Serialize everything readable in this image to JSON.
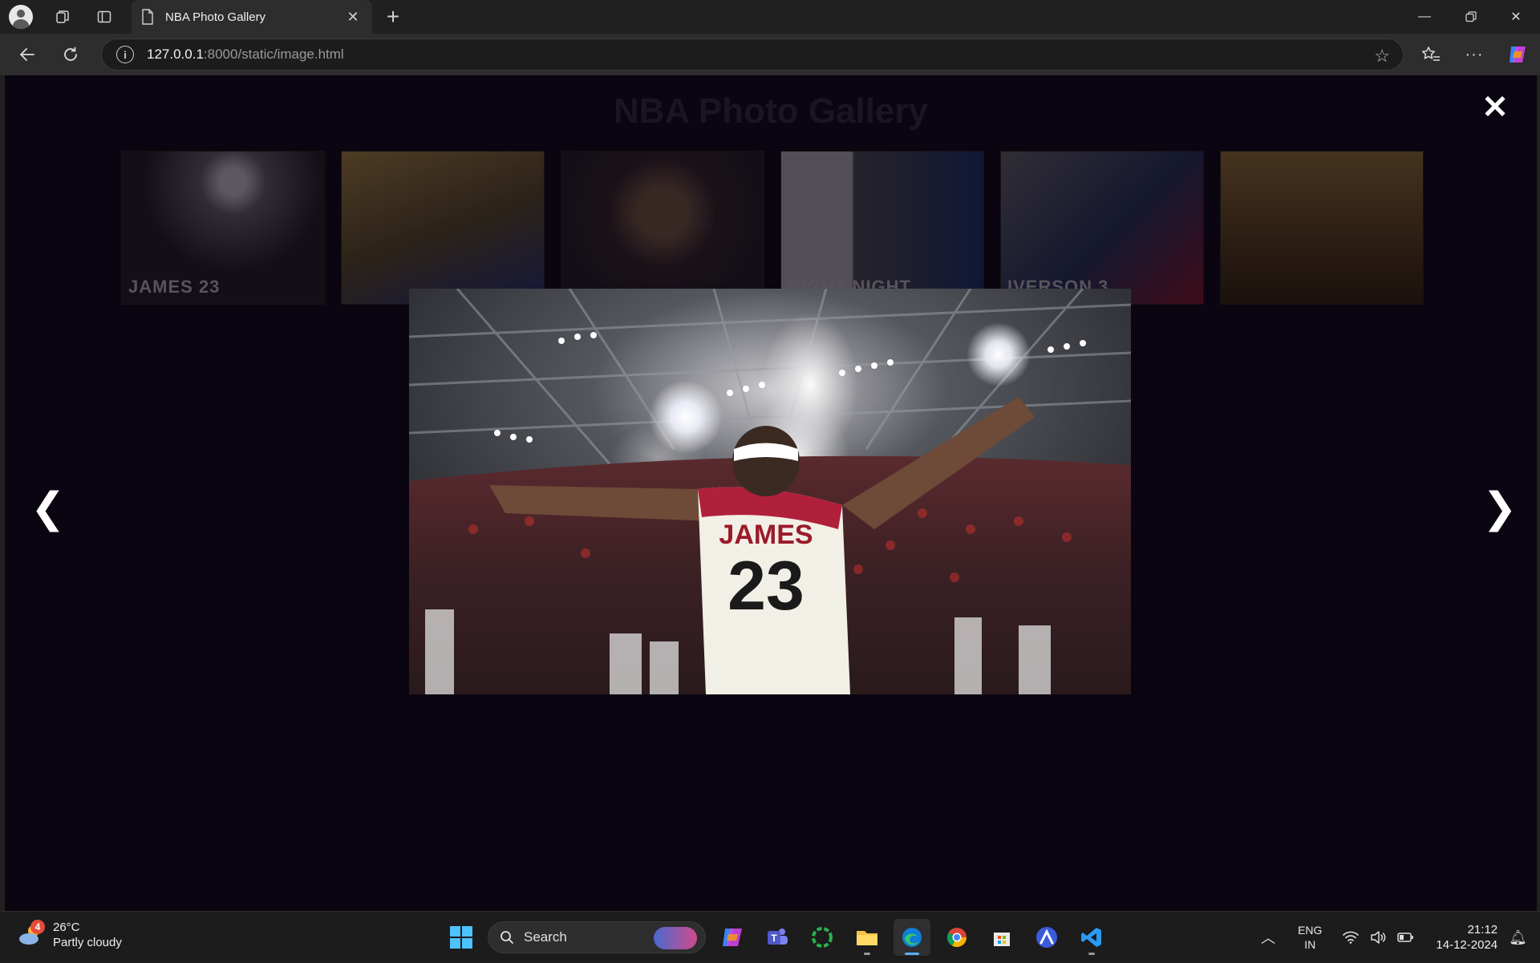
{
  "browser": {
    "tab_title": "NBA Photo Gallery",
    "url_host": "127.0.0.1",
    "url_path": ":8000/static/image.html"
  },
  "page": {
    "title": "NBA Photo Gallery",
    "thumbnails": [
      {
        "label": "JAMES 23"
      },
      {
        "label": ""
      },
      {
        "label": ""
      },
      {
        "label": "NIGHT NIGHT"
      },
      {
        "label": "IVERSON 3"
      },
      {
        "label": ""
      }
    ],
    "lightbox": {
      "jersey_name": "JAMES",
      "jersey_number": "23",
      "close_glyph": "✕",
      "prev_glyph": "❮",
      "next_glyph": "❯"
    }
  },
  "taskbar": {
    "weather_temp": "26°C",
    "weather_desc": "Partly cloudy",
    "weather_badge": "4",
    "search_label": "Search",
    "lang_line1": "ENG",
    "lang_line2": "IN",
    "time": "21:12",
    "date": "14-12-2024"
  }
}
